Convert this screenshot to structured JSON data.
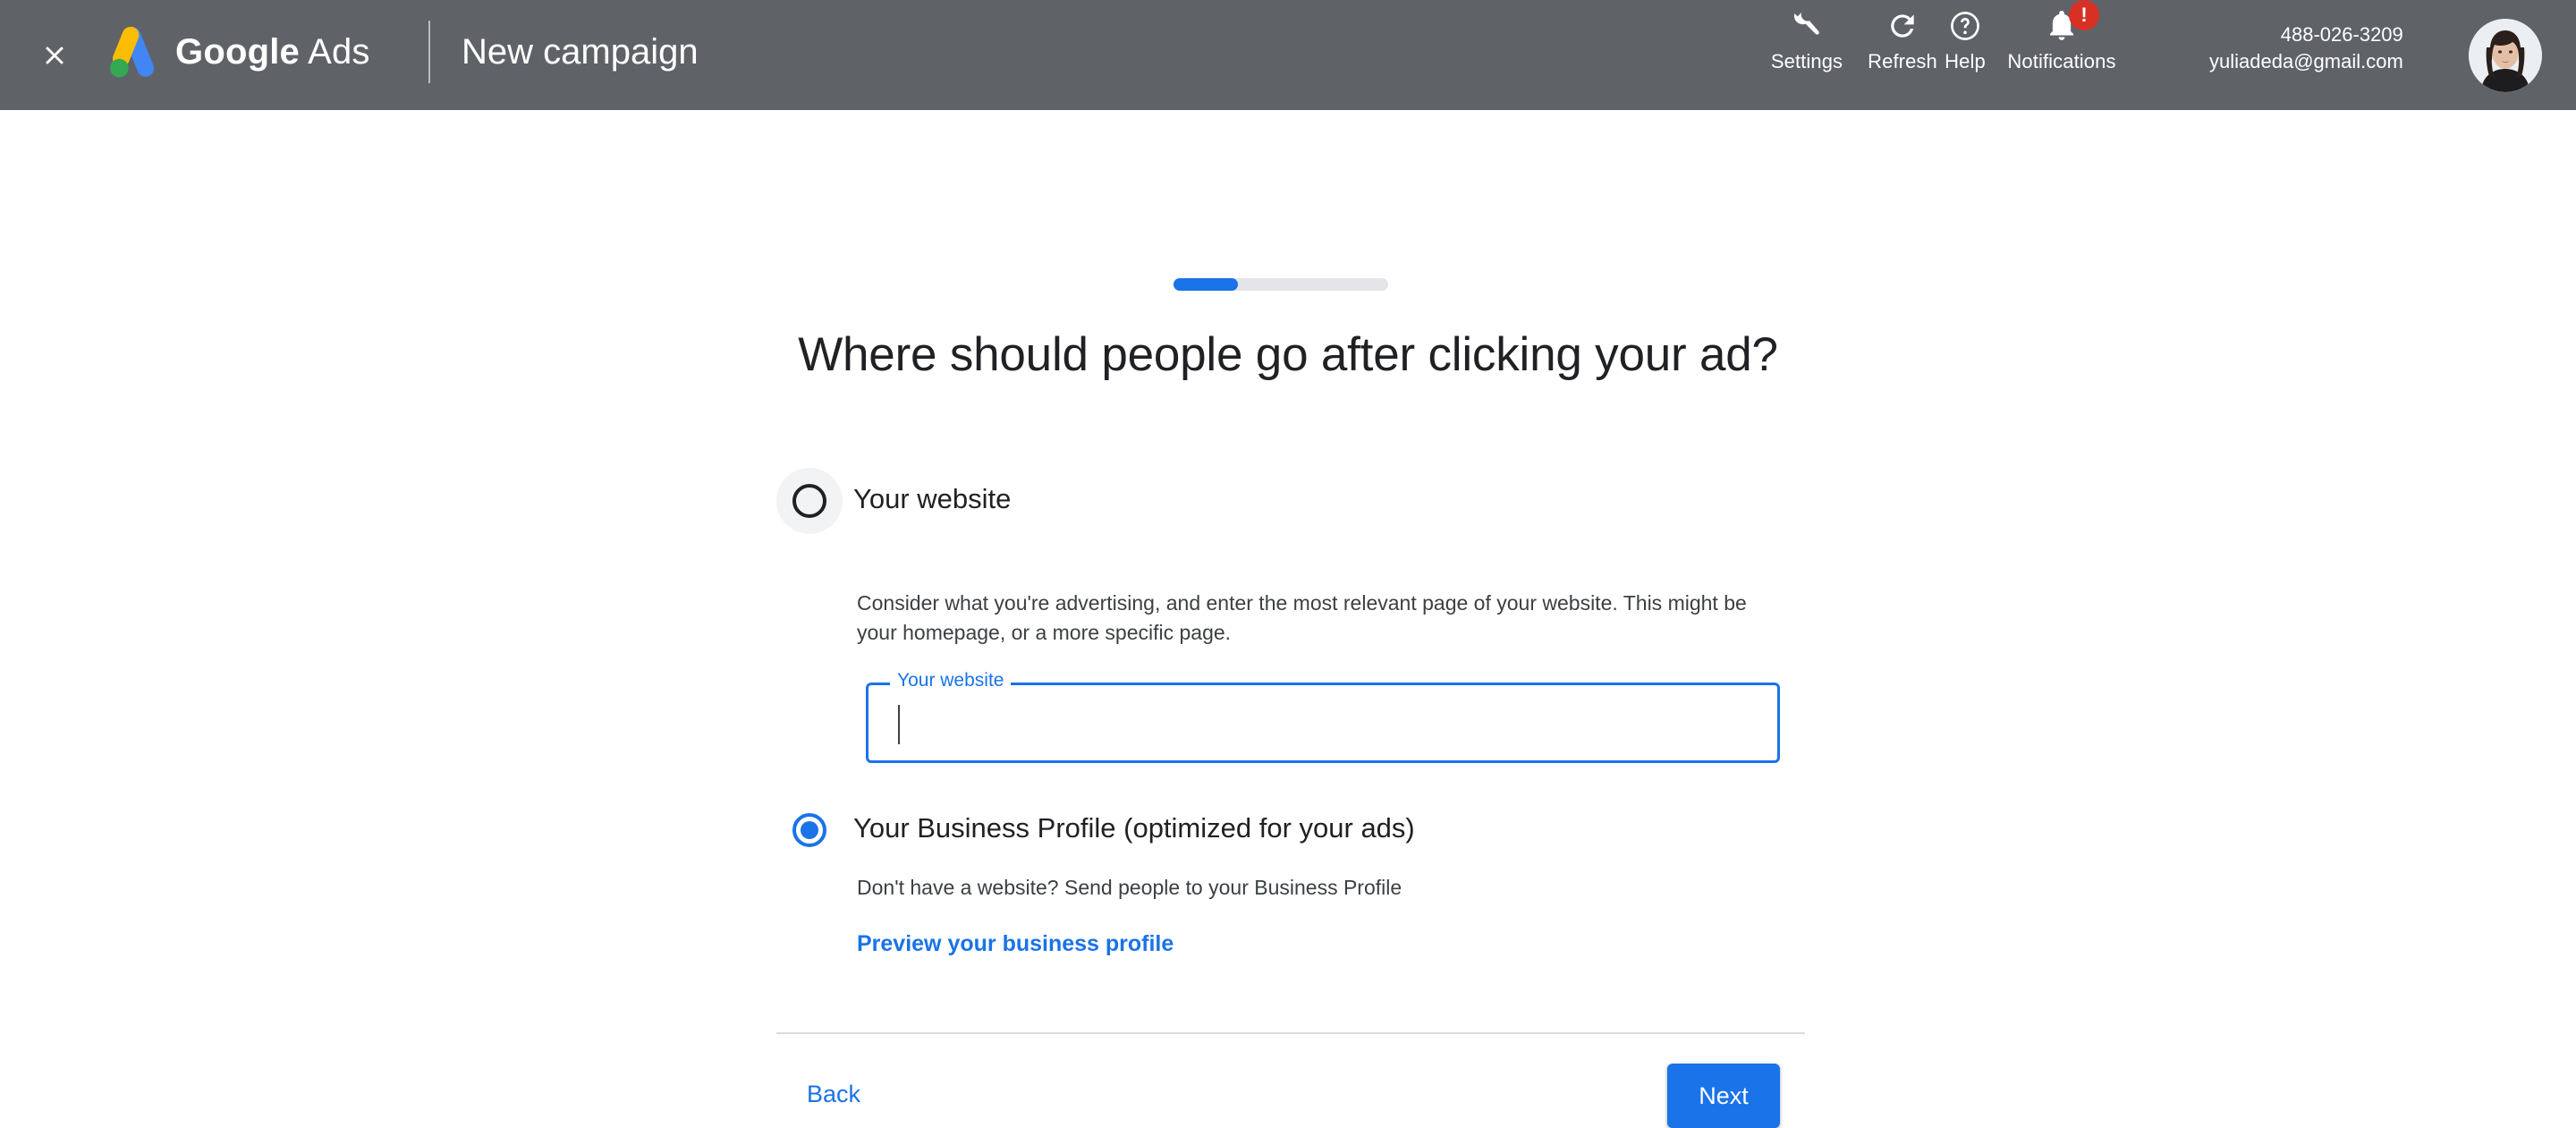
{
  "header": {
    "close_icon": "close-icon",
    "logo_icon": "google-ads-logo",
    "brand_bold": "Google",
    "brand_regular": "Ads",
    "page_title": "New campaign",
    "actions": [
      {
        "label": "Settings",
        "icon": "wrench-icon"
      },
      {
        "label": "Refresh",
        "icon": "refresh-icon"
      },
      {
        "label": "Help",
        "icon": "help-circle-icon"
      },
      {
        "label": "Notifications",
        "icon": "bell-icon",
        "badge": "!"
      }
    ],
    "account": {
      "customer_id": "488-026-3209",
      "email": "yuliadeda@gmail.com",
      "avatar_icon": "user-avatar"
    },
    "background_color": "#5f6368"
  },
  "progress": {
    "percent": 30,
    "fill_color": "#1a73e8",
    "track_color": "#e3e5e8"
  },
  "main": {
    "headline": "Where should people go after clicking your ad?",
    "options": [
      {
        "label": "Your website",
        "selected": false,
        "description": "Consider what you're advertising, and enter the most relevant page of your website. This might be your homepage, or a more specific page."
      },
      {
        "label": "Your Business Profile (optimized for your ads)",
        "selected": true,
        "description": "Don't have a website? Send people to your Business Profile"
      }
    ],
    "website_field": {
      "label": "Your website",
      "value": "",
      "placeholder": "",
      "focused": true,
      "accent_color": "#1a73e8"
    },
    "preview_link": "Preview your business profile"
  },
  "footer": {
    "back_label": "Back",
    "next_label": "Next",
    "next_color": "#1a73e8"
  }
}
